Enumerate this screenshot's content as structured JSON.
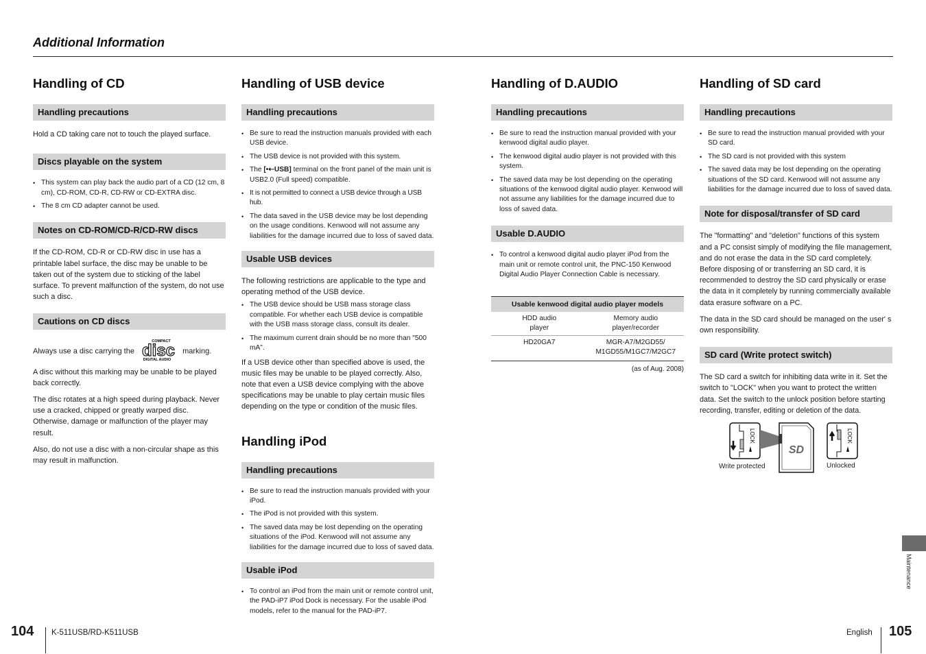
{
  "header": {
    "title": "Additional Information"
  },
  "cd": {
    "title": "Handling of CD",
    "s1": {
      "heading": "Handling precautions",
      "text": "Hold a CD taking care not to touch the played surface."
    },
    "s2": {
      "heading": "Discs playable on the system",
      "items": [
        "This system can play back the audio part of a CD (12 cm, 8 cm), CD-ROM, CD-R, CD-RW or CD-EXTRA disc.",
        "The 8 cm CD adapter cannot be used."
      ]
    },
    "s3": {
      "heading": "Notes on CD-ROM/CD-R/CD-RW discs",
      "text": "If the CD-ROM, CD-R or CD-RW disc in use has a printable label surface, the disc may be unable to be taken out of the system due to sticking of the label surface. To prevent malfunction of the system, do not use such a disc."
    },
    "s4": {
      "heading": "Cautions on CD discs",
      "logo_pre": "Always use a disc carrying the",
      "logo_post": "marking.",
      "logo_top": "COMPACT",
      "logo_main": "disc",
      "logo_bottom": "DIGITAL AUDIO",
      "p1": "A disc without this marking may be unable to be played back correctly.",
      "p2": "The disc rotates at a high speed during playback. Never use a cracked, chipped or greatly warped disc. Otherwise, damage or malfunction of the player may result.",
      "p3": "Also, do not use a disc with a non-circular shape as this may result in malfunction."
    }
  },
  "usb": {
    "title": "Handling of USB device",
    "s1": {
      "heading": "Handling precautions",
      "item0": "Be sure to read the instruction manuals provided with each USB device.",
      "item1": "The USB device is not provided with this system.",
      "item2_pre": "The ",
      "item2_bold": "[•⇠USB]",
      "item2_post": " terminal on the front panel of the main unit is USB2.0 (Full speed) compatible.",
      "item3": "It is not permitted to connect a USB device through a USB hub.",
      "item4": "The data saved in the USB device may be lost depending on the usage conditions. Kenwood will not assume any liabilities for the damage incurred due to loss of saved data."
    },
    "s2": {
      "heading": "Usable USB devices",
      "intro": "The following restrictions are applicable to the type and operating method of the USB device.",
      "items": [
        "The USB device should be USB mass storage class compatible. For whether each USB device is compatible with the USB mass storage class, consult its dealer.",
        "The maximum current drain should be no more than \"500 mA\"."
      ],
      "outro": "If a USB device other than specified above is used, the music files may be unable to be played correctly. Also, note that even a USB device complying with the above specifications may be unable to play certain music files depending on the type or condition of the music files."
    }
  },
  "ipod": {
    "title": "Handling iPod",
    "s1": {
      "heading": "Handling precautions",
      "items": [
        "Be sure to read the instruction manuals provided with your iPod.",
        "The iPod is not provided with this system.",
        "The saved data may be lost depending on the operating situations of the iPod. Kenwood will not assume any liabilities for the damage incurred due to loss of saved data."
      ]
    },
    "s2": {
      "heading": "Usable iPod",
      "items": [
        "To control an iPod from the main unit or remote control unit, the PAD-iP7 iPod Dock is necessary. For the usable iPod models, refer to the manual for the PAD-iP7."
      ]
    }
  },
  "daudio": {
    "title": "Handling of D.AUDIO",
    "s1": {
      "heading": "Handling precautions",
      "items": [
        "Be sure to read the instruction manual provided with your kenwood digital audio player.",
        "The kenwood digital audio player is not provided with this system.",
        "The saved data may be lost depending on the operating situations of the kenwood digital audio player. Kenwood will not assume any liabilities for the damage incurred due to loss of saved data."
      ]
    },
    "s2": {
      "heading": "Usable D.AUDIO",
      "items": [
        "To control a kenwood digital audio player iPod from the main unit or remote control unit, the PNC-150 Kenwood Digital Audio Player Connection Cable is necessary."
      ]
    },
    "table": {
      "title": "Usable kenwood digital audio player models",
      "columns": [
        "HDD audio player",
        "Memory audio player/recorder"
      ],
      "rows": [
        [
          "HD20GA7",
          "MGR-A7/M2GD55/ M1GD55/M1GC7/M2GC7"
        ]
      ],
      "note": "(as of Aug. 2008)"
    }
  },
  "sd": {
    "title": "Handling of SD card",
    "s1": {
      "heading": "Handling precautions",
      "items": [
        "Be sure to read the instruction manual provided with your SD card.",
        "The SD card is not provided with this system",
        "The saved data may be lost depending on the operating situations of the SD card. Kenwood will not assume any liabilities for the damage incurred due to loss of saved data."
      ]
    },
    "s2": {
      "heading": "Note for disposal/transfer of SD card",
      "p1": "The \"formatting\" and \"deletion\" functions of this system and a PC consist simply of modifying the file management, and do not erase the data in the SD card completely. Before disposing of or transferring an SD card, it is recommended to destroy the SD card physically or erase the data in it completely by running commercially available data erasure software on a PC.",
      "p2": "The data in the SD card should be managed on the user' s own responsibility."
    },
    "s3": {
      "heading": "SD card (Write protect switch)",
      "p1": "The SD card a switch for inhibiting data write in it. Set the switch to \"LOCK\" when you want to protect the written data. Set the switch to the unlock position before starting recording, transfer, editing or deletion of the data.",
      "fig_left": "Write protected",
      "fig_right": "Unlocked",
      "lock_text": "LOCK",
      "sd_logo": "SD"
    }
  },
  "footer": {
    "left_page": "104",
    "model": "K-511USB/RD-K511USB",
    "language": "English",
    "right_page": "105",
    "side_tab": "Maintenance"
  }
}
